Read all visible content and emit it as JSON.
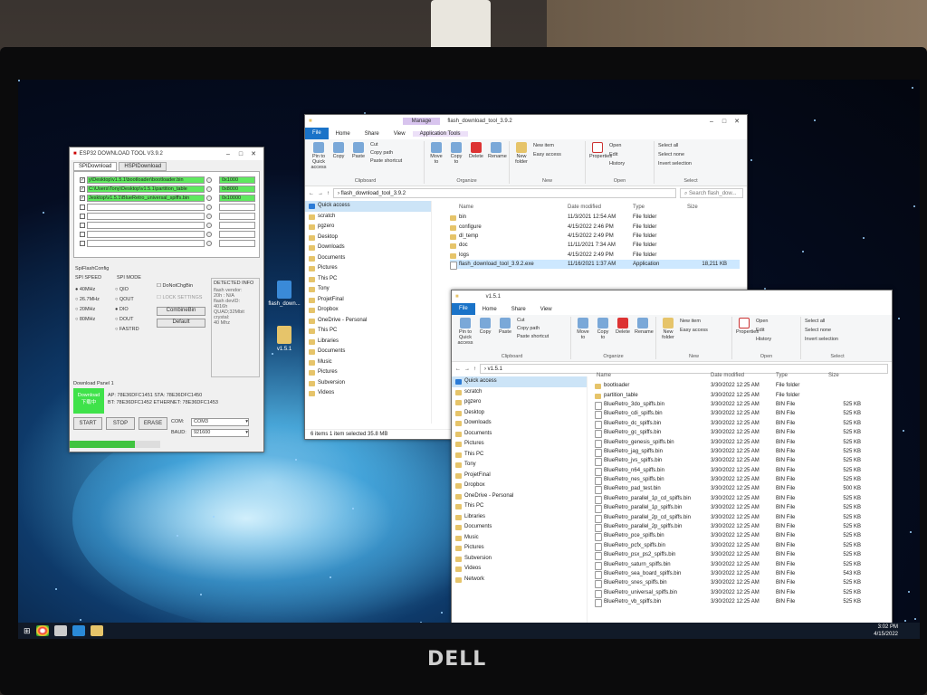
{
  "esp": {
    "title": "ESP32 DOWNLOAD TOOL V3.9.2",
    "tabs": [
      "SPIDownload",
      "HSPIDownload"
    ],
    "files": [
      {
        "path": "y\\Desktop\\v1.5.1\\bootloader\\bootloader.bin",
        "addr": "0x1000",
        "checked": true
      },
      {
        "path": "C:\\Users\\Tony\\Desktop\\v1.5.1\\partition_table",
        "addr": "0x8000",
        "checked": true
      },
      {
        "path": "Jesktop\\v1.5.1\\BlueRetro_universal_spiffs.bin",
        "addr": "0x10000",
        "checked": true
      }
    ],
    "spi_flash_config": "SpiFlashConfig",
    "spi_speed_label": "SPI SPEED",
    "spi_speeds": [
      "40MHz",
      "26.7MHz",
      "20MHz",
      "80MHz"
    ],
    "spi_mode_label": "SPI MODE",
    "spi_modes": [
      "QIO",
      "QOUT",
      "DIO",
      "DOUT",
      "FASTRD"
    ],
    "do_not_chg_bin": "DoNotChgBin",
    "lock_settings": "LOCK SETTINGS",
    "combine_bin": "CombineBin",
    "default": "Default",
    "detected_info_label": "DETECTED INFO",
    "detected_info": "flash vendor:\n20h : N/A\nflash devID:\n4016h\nQUAD;32Mbit\ncrystal:\n40 Mhz",
    "download_panel": "Download Panel 1",
    "status_label": "Download",
    "status_sub": "下载中",
    "ap_line": "AP: 78E36DFC1451  STA: 78E36DFC1450",
    "bt_line": "BT: 78E36DFC1452  ETHERNET: 78E36DFC1453",
    "start": "START",
    "stop": "STOP",
    "erase": "ERASE",
    "com_label": "COM:",
    "com_value": "COM3",
    "baud_label": "BAUD:",
    "baud_value": "921600",
    "progress": 0.72
  },
  "desktop_icons": [
    "flash_down...",
    "v1.5.1"
  ],
  "explorer1": {
    "title": "flash_download_tool_3.9.2",
    "manage": "Manage",
    "app_tools": "Application Tools",
    "ribbon_tabs": [
      "File",
      "Home",
      "Share",
      "View"
    ],
    "ribbon": {
      "pin": "Pin to Quick access",
      "copy": "Copy",
      "paste": "Paste",
      "cut": "Cut",
      "copy_path": "Copy path",
      "paste_shortcut": "Paste shortcut",
      "clipboard": "Clipboard",
      "move_to": "Move to",
      "copy_to": "Copy to",
      "delete": "Delete",
      "rename": "Rename",
      "organize": "Organize",
      "new_folder": "New folder",
      "new_item": "New item",
      "easy_access": "Easy access",
      "new": "New",
      "properties": "Properties",
      "open": "Open",
      "edit": "Edit",
      "history": "History",
      "open_grp": "Open",
      "select_all": "Select all",
      "select_none": "Select none",
      "invert": "Invert selection",
      "select": "Select"
    },
    "path": "flash_download_tool_3.9.2",
    "search": "Search flash_dow...",
    "nav": [
      "Quick access",
      "scratch",
      "pgzero",
      "Desktop",
      "Downloads",
      "Documents",
      "Pictures",
      "This PC",
      "Tony",
      "ProjetFinal",
      "Dropbox",
      "OneDrive - Personal",
      "This PC",
      "Libraries",
      "Documents",
      "Music",
      "Pictures",
      "Subversion",
      "Videos"
    ],
    "columns": [
      "Name",
      "Date modified",
      "Type",
      "Size"
    ],
    "rows": [
      {
        "name": "bin",
        "date": "11/3/2021 12:54 AM",
        "type": "File folder",
        "size": ""
      },
      {
        "name": "configure",
        "date": "4/15/2022 2:46 PM",
        "type": "File folder",
        "size": ""
      },
      {
        "name": "dl_temp",
        "date": "4/15/2022 2:49 PM",
        "type": "File folder",
        "size": ""
      },
      {
        "name": "doc",
        "date": "11/11/2021 7:34 AM",
        "type": "File folder",
        "size": ""
      },
      {
        "name": "logs",
        "date": "4/15/2022 2:49 PM",
        "type": "File folder",
        "size": ""
      },
      {
        "name": "flash_download_tool_3.9.2.exe",
        "date": "11/16/2021 1:37 AM",
        "type": "Application",
        "size": "18,211 KB"
      }
    ],
    "status": "6 items    1 item selected  35.8 MB"
  },
  "explorer2": {
    "title": "v1.5.1",
    "ribbon_tabs": [
      "File",
      "Home",
      "Share",
      "View"
    ],
    "path": "v1.5.1",
    "nav": [
      "Quick access",
      "scratch",
      "pgzero",
      "Desktop",
      "Downloads",
      "Documents",
      "Pictures",
      "This PC",
      "Tony",
      "ProjetFinal",
      "Dropbox",
      "OneDrive - Personal",
      "This PC",
      "Libraries",
      "Documents",
      "Music",
      "Pictures",
      "Subversion",
      "Videos",
      "Network"
    ],
    "columns": [
      "Name",
      "Date modified",
      "Type",
      "Size"
    ],
    "rows": [
      {
        "name": "bootloader",
        "date": "3/30/2022 12:25 AM",
        "type": "File folder",
        "size": ""
      },
      {
        "name": "partition_table",
        "date": "3/30/2022 12:25 AM",
        "type": "File folder",
        "size": ""
      },
      {
        "name": "BlueRetro_3do_spiffs.bin",
        "date": "3/30/2022 12:25 AM",
        "type": "BIN File",
        "size": "525 KB"
      },
      {
        "name": "BlueRetro_cdi_spiffs.bin",
        "date": "3/30/2022 12:25 AM",
        "type": "BIN File",
        "size": "525 KB"
      },
      {
        "name": "BlueRetro_dc_spiffs.bin",
        "date": "3/30/2022 12:25 AM",
        "type": "BIN File",
        "size": "525 KB"
      },
      {
        "name": "BlueRetro_gc_spiffs.bin",
        "date": "3/30/2022 12:25 AM",
        "type": "BIN File",
        "size": "525 KB"
      },
      {
        "name": "BlueRetro_genesis_spiffs.bin",
        "date": "3/30/2022 12:25 AM",
        "type": "BIN File",
        "size": "525 KB"
      },
      {
        "name": "BlueRetro_jag_spiffs.bin",
        "date": "3/30/2022 12:25 AM",
        "type": "BIN File",
        "size": "525 KB"
      },
      {
        "name": "BlueRetro_jvs_spiffs.bin",
        "date": "3/30/2022 12:25 AM",
        "type": "BIN File",
        "size": "525 KB"
      },
      {
        "name": "BlueRetro_n64_spiffs.bin",
        "date": "3/30/2022 12:25 AM",
        "type": "BIN File",
        "size": "525 KB"
      },
      {
        "name": "BlueRetro_nes_spiffs.bin",
        "date": "3/30/2022 12:25 AM",
        "type": "BIN File",
        "size": "525 KB"
      },
      {
        "name": "BlueRetro_pad_test.bin",
        "date": "3/30/2022 12:25 AM",
        "type": "BIN File",
        "size": "500 KB"
      },
      {
        "name": "BlueRetro_parallel_1p_cd_spiffs.bin",
        "date": "3/30/2022 12:25 AM",
        "type": "BIN File",
        "size": "525 KB"
      },
      {
        "name": "BlueRetro_parallel_1p_spiffs.bin",
        "date": "3/30/2022 12:25 AM",
        "type": "BIN File",
        "size": "525 KB"
      },
      {
        "name": "BlueRetro_parallel_2p_cd_spiffs.bin",
        "date": "3/30/2022 12:25 AM",
        "type": "BIN File",
        "size": "525 KB"
      },
      {
        "name": "BlueRetro_parallel_2p_spiffs.bin",
        "date": "3/30/2022 12:25 AM",
        "type": "BIN File",
        "size": "525 KB"
      },
      {
        "name": "BlueRetro_pce_spiffs.bin",
        "date": "3/30/2022 12:25 AM",
        "type": "BIN File",
        "size": "525 KB"
      },
      {
        "name": "BlueRetro_pcfx_spiffs.bin",
        "date": "3/30/2022 12:25 AM",
        "type": "BIN File",
        "size": "525 KB"
      },
      {
        "name": "BlueRetro_psx_ps2_spiffs.bin",
        "date": "3/30/2022 12:25 AM",
        "type": "BIN File",
        "size": "525 KB"
      },
      {
        "name": "BlueRetro_saturn_spiffs.bin",
        "date": "3/30/2022 12:25 AM",
        "type": "BIN File",
        "size": "525 KB"
      },
      {
        "name": "BlueRetro_sea_board_spiffs.bin",
        "date": "3/30/2022 12:25 AM",
        "type": "BIN File",
        "size": "543 KB"
      },
      {
        "name": "BlueRetro_snes_spiffs.bin",
        "date": "3/30/2022 12:25 AM",
        "type": "BIN File",
        "size": "525 KB"
      },
      {
        "name": "BlueRetro_universal_spiffs.bin",
        "date": "3/30/2022 12:25 AM",
        "type": "BIN File",
        "size": "525 KB"
      },
      {
        "name": "BlueRetro_vb_spiffs.bin",
        "date": "3/30/2022 12:25 AM",
        "type": "BIN File",
        "size": "525 KB"
      }
    ]
  },
  "taskbar": {
    "time": "3:02 PM",
    "date": "4/15/2022"
  },
  "brand": "DELL"
}
